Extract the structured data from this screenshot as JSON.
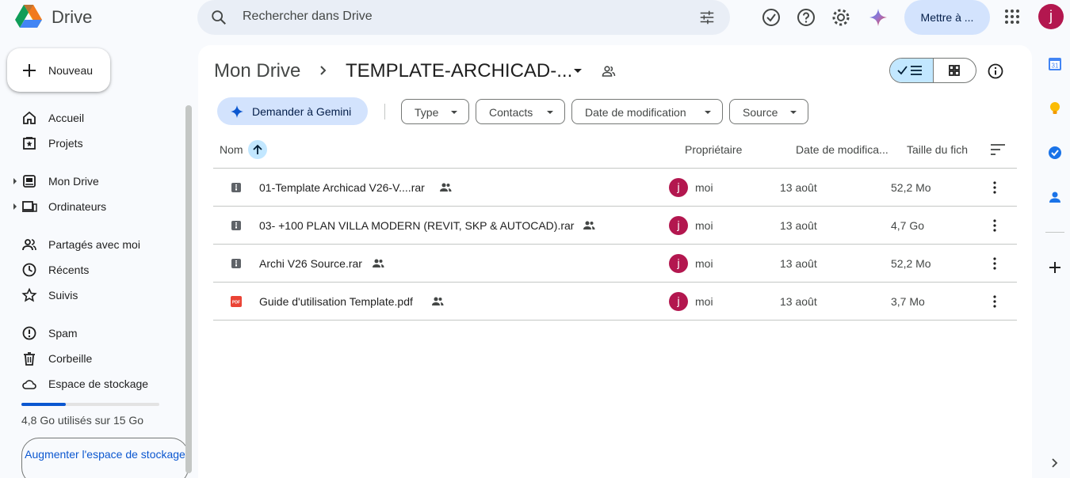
{
  "app": {
    "name": "Drive",
    "search_placeholder": "Rechercher dans Drive",
    "upgrade_label": "Mettre à ...",
    "avatar_initial": "j"
  },
  "sidebar": {
    "new_label": "Nouveau",
    "items": [
      {
        "label": "Accueil",
        "icon": "home-icon"
      },
      {
        "label": "Projets",
        "icon": "projects-icon"
      },
      {
        "label": "Mon Drive",
        "icon": "my-drive-icon"
      },
      {
        "label": "Ordinateurs",
        "icon": "computers-icon"
      },
      {
        "label": "Partagés avec moi",
        "icon": "shared-icon"
      },
      {
        "label": "Récents",
        "icon": "clock-icon"
      },
      {
        "label": "Suivis",
        "icon": "star-icon"
      },
      {
        "label": "Spam",
        "icon": "spam-icon"
      },
      {
        "label": "Corbeille",
        "icon": "trash-icon"
      },
      {
        "label": "Espace de stockage",
        "icon": "cloud-icon"
      }
    ],
    "storage_text": "4,8 Go utilisés sur 15 Go",
    "storage_fraction": 0.32,
    "storage_button": "Augmenter l'espace de stockage"
  },
  "breadcrumb": {
    "root": "Mon Drive",
    "current": "TEMPLATE-ARCHICAD-..."
  },
  "filters": {
    "gemini_label": "Demander à Gemini",
    "chips": [
      "Type",
      "Contacts",
      "Date de modification",
      "Source"
    ]
  },
  "table": {
    "columns": {
      "name": "Nom",
      "owner": "Propriétaire",
      "modified": "Date de modifica...",
      "size": "Taille du fich"
    },
    "rows": [
      {
        "name": "01-Template Archicad V26-V....rar",
        "type": "archive",
        "owner": "moi",
        "owner_initial": "j",
        "modified": "13 août",
        "size": "52,2 Mo"
      },
      {
        "name": "03-  +100 PLAN VILLA MODERN (REVIT, SKP & AUTOCAD).rar",
        "type": "archive",
        "owner": "moi",
        "owner_initial": "j",
        "modified": "13 août",
        "size": "4,7 Go"
      },
      {
        "name": "Archi V26 Source.rar",
        "type": "archive",
        "owner": "moi",
        "owner_initial": "j",
        "modified": "13 août",
        "size": "52,2 Mo"
      },
      {
        "name": "Guide d'utilisation Template.pdf",
        "type": "pdf",
        "owner": "moi",
        "owner_initial": "j",
        "modified": "13 août",
        "size": "3,7 Mo"
      }
    ]
  },
  "colors": {
    "accent": "#0b57d0",
    "selected": "#c2e7ff",
    "avatar": "#b3174f",
    "pdf": "#ea4335"
  }
}
